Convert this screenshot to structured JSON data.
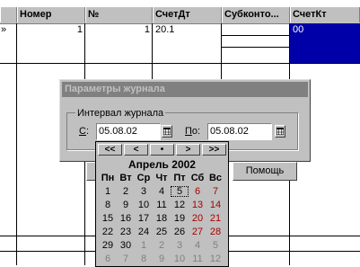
{
  "grid": {
    "headers": [
      "",
      "Номер",
      "№",
      "СчетДт",
      "Субконто...",
      "СчетКт"
    ],
    "row1": {
      "first_cell": "»",
      "nomer": "1",
      "num": "1",
      "schet_dt": "20.1",
      "schet_kt": "00"
    }
  },
  "dialog": {
    "title": "Параметры журнала",
    "group_label": "Интервал журнала",
    "from_label_key": "С",
    "from_label_rest": ":",
    "from_value": "05.08.02",
    "to_label_key": "П",
    "to_label_rest": "о:",
    "to_value": "05.08.02",
    "help_button": "Помощь"
  },
  "calendar": {
    "nav": [
      "<<",
      "<",
      "•",
      ">",
      ">>"
    ],
    "month_title": "Апрель 2002",
    "weekdays": [
      "Пн",
      "Вт",
      "Ср",
      "Чт",
      "Пт",
      "Сб",
      "Вс"
    ],
    "weeks": [
      [
        "1",
        "2",
        "3",
        "4",
        "5",
        "6",
        "7"
      ],
      [
        "8",
        "9",
        "10",
        "11",
        "12",
        "13",
        "14"
      ],
      [
        "15",
        "16",
        "17",
        "18",
        "19",
        "20",
        "21"
      ],
      [
        "22",
        "23",
        "24",
        "25",
        "26",
        "27",
        "28"
      ],
      [
        "29",
        "30",
        "1",
        "2",
        "3",
        "4",
        "5"
      ],
      [
        "6",
        "7",
        "8",
        "9",
        "10",
        "11",
        "12"
      ]
    ],
    "selected_day": "5",
    "colors": {
      "weekend": "#a80000",
      "other_month": "#808080",
      "selection": "#0000a8"
    }
  }
}
